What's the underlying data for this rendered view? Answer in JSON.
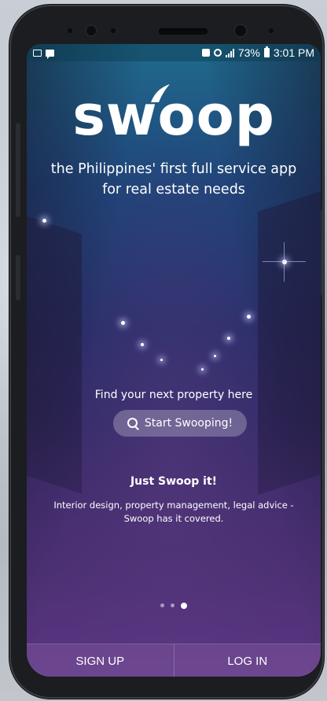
{
  "status_bar": {
    "battery": "73%",
    "time": "3:01 PM",
    "icons": [
      "image-icon",
      "message-icon",
      "nfc-icon",
      "alarm-icon",
      "signal-icon",
      "battery-icon"
    ]
  },
  "app": {
    "logo_text": "swoop",
    "tagline": "the Philippines' first full service app for real estate needs",
    "find_text": "Find your next property here",
    "search_button": "Start Swooping!",
    "slide_title": "Just Swoop it!",
    "slide_desc": "Interior design, property management, legal advice - Swoop has it covered.",
    "pager": {
      "total": 3,
      "active": 3
    },
    "sign_up": "SIGN UP",
    "log_in": "LOG IN"
  },
  "colors": {
    "accent": "#55307a",
    "top": "#1f6b8e"
  }
}
